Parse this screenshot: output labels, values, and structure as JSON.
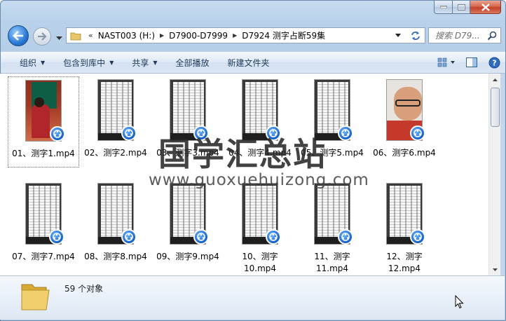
{
  "window": {
    "title_buttons": [
      "minimize-icon",
      "maximize-icon",
      "close-icon"
    ]
  },
  "nav": {
    "breadcrumb": [
      "NAST003 (H:)",
      "D7900-D7999",
      "D7924 测字占断59集"
    ],
    "overflow_glyph": "«",
    "search_placeholder": "搜索 D79..."
  },
  "commands": {
    "organize": "组织",
    "include_in_library": "包含到库中",
    "share": "共享",
    "play_all": "全部播放",
    "new_folder": "新建文件夹"
  },
  "files": [
    {
      "label": "01、测字1.mp4",
      "thumb": "person"
    },
    {
      "label": "02、测字2.mp4",
      "thumb": "paper"
    },
    {
      "label": "03、测字3.mp4",
      "thumb": "paper"
    },
    {
      "label": "04、测字4.mp4",
      "thumb": "paper"
    },
    {
      "label": "05、测字5.mp4",
      "thumb": "paper"
    },
    {
      "label": "06、测字6.mp4",
      "thumb": "face"
    },
    {
      "label": "07、测字7.mp4",
      "thumb": "paper"
    },
    {
      "label": "08、测字8.mp4",
      "thumb": "paper"
    },
    {
      "label": "09、测字9.mp4",
      "thumb": "paper"
    },
    {
      "label": "10、测字\n10.mp4",
      "thumb": "paper"
    },
    {
      "label": "11、测字\n11.mp4",
      "thumb": "paper"
    },
    {
      "label": "12、测字\n12.mp4",
      "thumb": "paper"
    }
  ],
  "watermark": {
    "title": "国学汇总站",
    "url": "www.guoxuehuizong.com"
  },
  "details": {
    "count": "59 个对象"
  },
  "colors": {
    "accent": "#1e395b",
    "badge": "#1561c8"
  }
}
